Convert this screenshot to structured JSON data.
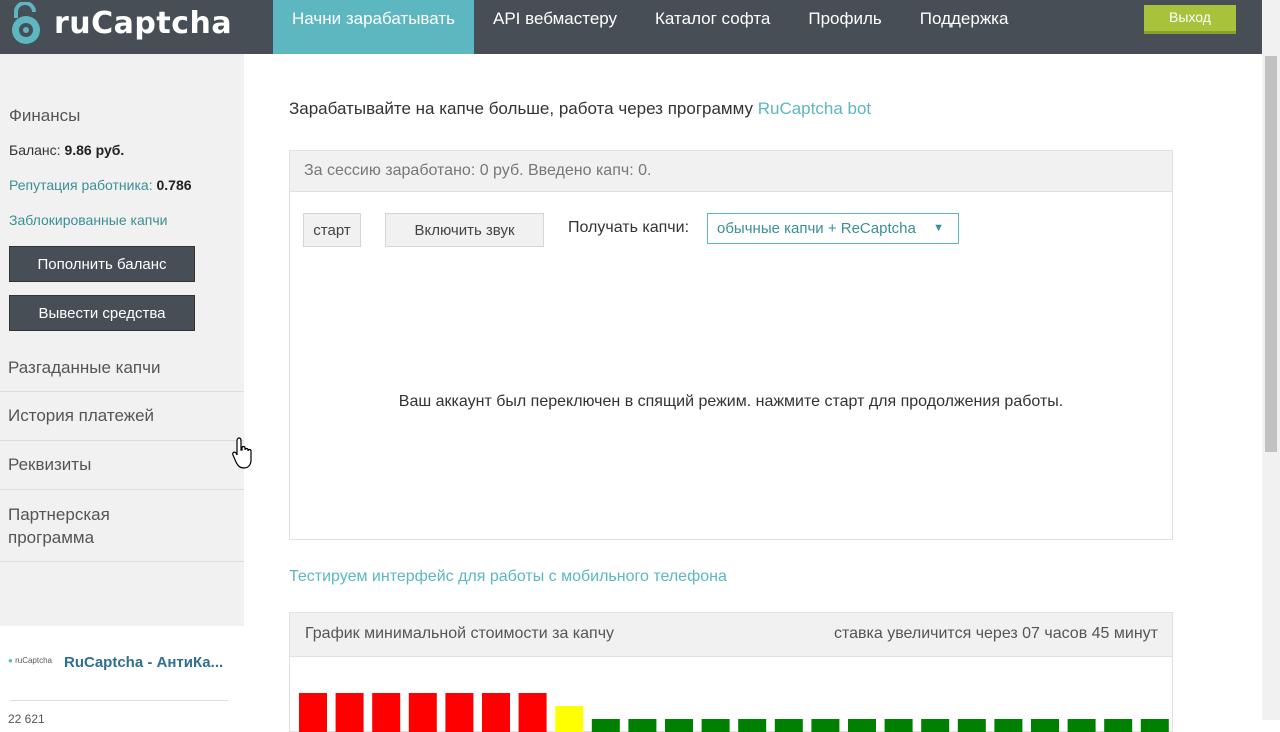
{
  "header": {
    "logo_text": "ruCaptcha",
    "nav": [
      {
        "label": "Начни зарабатывать",
        "active": true
      },
      {
        "label": "API вебмастеру",
        "active": false
      },
      {
        "label": "Каталог софта",
        "active": false
      },
      {
        "label": "Профиль",
        "active": false
      },
      {
        "label": "Поддержка",
        "active": false
      }
    ],
    "logout_label": "Выход"
  },
  "sidebar": {
    "finance_title": "Финансы",
    "balance_label": "Баланс:",
    "balance_value": "9.86 руб.",
    "reputation_label": "Репутация работника:",
    "reputation_value": "0.786",
    "blocked_link": "Заблокированные капчи",
    "topup_button": "Пополнить баланс",
    "withdraw_button": "Вывести средства",
    "menu": [
      "Разгаданные капчи",
      "История платежей",
      "Реквизиты",
      "Партнерская программа"
    ],
    "card_logo": "ruCaptcha",
    "card_title": "RuCaptcha - АнтиКа...",
    "card_bottom": "22 621"
  },
  "main": {
    "promo_text": "Зарабатывайте на капче больше, работа через программу ",
    "promo_link": "RuCaptcha bot",
    "session_text": "За сессию заработано: 0 руб. Введено капч: 0.",
    "start_button": "старт",
    "sound_button": "Включить звук",
    "receive_label": "Получать капчи:",
    "receive_selected": "обычные капчи + ReCaptcha",
    "sleep_message": "Ваш аккаунт был переключен в спящий режим. нажмите старт для продолжения работы.",
    "mobile_link": "Тестируем интерфейс для работы с мобильного телефона",
    "chart_title": "График минимальной стоимости за капчу",
    "chart_note": "ставка увеличится через 07 часов 45 минут"
  },
  "colors": {
    "header_bg": "#474e55",
    "accent": "#5cb7c0",
    "logout": "#a8c23c",
    "bar_high": "#ff0000",
    "bar_mid": "#ffff00",
    "bar_low": "#008000"
  },
  "chart_data": {
    "type": "bar",
    "values": [
      3,
      3,
      3,
      3,
      3,
      3,
      3,
      2,
      1,
      1,
      1,
      1,
      1,
      1,
      1,
      1,
      1,
      1,
      1,
      1,
      1,
      1,
      1,
      1
    ],
    "levels": [
      "high",
      "high",
      "high",
      "high",
      "high",
      "high",
      "high",
      "mid",
      "low",
      "low",
      "low",
      "low",
      "low",
      "low",
      "low",
      "low",
      "low",
      "low",
      "low",
      "low",
      "low",
      "low",
      "low",
      "low"
    ],
    "title": "График минимальной стоимости за капчу"
  }
}
